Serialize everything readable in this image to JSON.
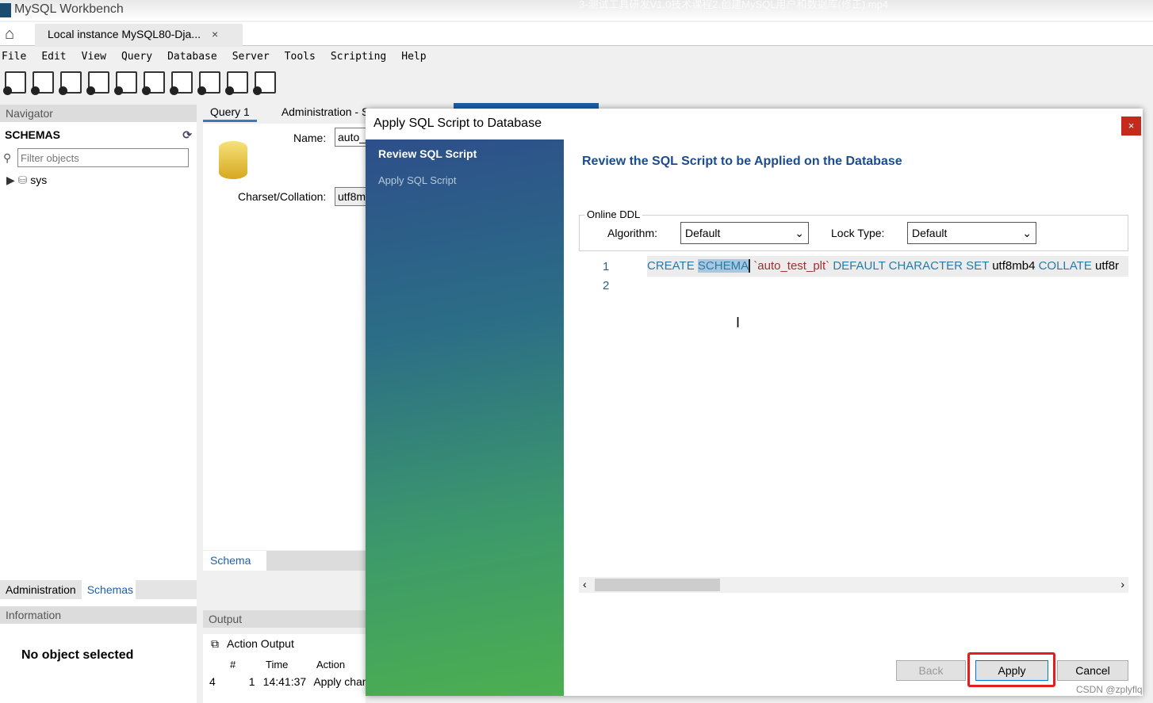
{
  "window": {
    "title": "MySQL Workbench",
    "video_title": "3-测试工具研发V1.0技术课程2.创建MySQL用户和数据库(修正).mp4"
  },
  "tabs": {
    "connection": "Local instance MySQL80-Dja...",
    "close": "×"
  },
  "menu": [
    "File",
    "Edit",
    "View",
    "Query",
    "Database",
    "Server",
    "Tools",
    "Scripting",
    "Help"
  ],
  "navigator": {
    "title": "Navigator",
    "schemas_label": "SCHEMAS",
    "filter_placeholder": "Filter objects",
    "items": [
      "sys"
    ],
    "tabs": [
      "Administration",
      "Schemas"
    ],
    "info_title": "Information",
    "no_object": "No object selected"
  },
  "query_tabs": [
    "Query 1",
    "Administration - S"
  ],
  "editor": {
    "name_label": "Name:",
    "name_value": "auto_",
    "charset_label": "Charset/Collation:",
    "charset_value": "utf8m",
    "schema_tab": "Schema"
  },
  "output": {
    "title": "Output",
    "mode": "Action Output",
    "columns": [
      "#",
      "Time",
      "Action"
    ],
    "rows": [
      {
        "idx": "4",
        "num": "1",
        "time": "14:41:37",
        "action": "Apply chan"
      }
    ]
  },
  "dialog": {
    "title": "Apply SQL Script to Database",
    "close": "×",
    "steps": [
      "Review SQL Script",
      "Apply SQL Script"
    ],
    "heading": "Review the SQL Script to be Applied on the Database",
    "ddl_group": "Online DDL",
    "algorithm_label": "Algorithm:",
    "algorithm_value": "Default",
    "lock_label": "Lock Type:",
    "lock_value": "Default",
    "sql": {
      "line_numbers": [
        "1",
        "2"
      ],
      "kw1": "CREATE",
      "kw2": "SCHEMA",
      "name": "`auto_test_plt`",
      "kw3": "DEFAULT CHARACTER SET",
      "cs": "utf8mb4",
      "kw4": "COLLATE",
      "coll": "utf8r"
    },
    "buttons": {
      "back": "Back",
      "apply": "Apply",
      "cancel": "Cancel"
    }
  },
  "watermark": "CSDN @zplyflq",
  "colors": {
    "accent": "#1b4c8c",
    "highlight_ring": "#e02020",
    "close": "#c42b1c"
  }
}
